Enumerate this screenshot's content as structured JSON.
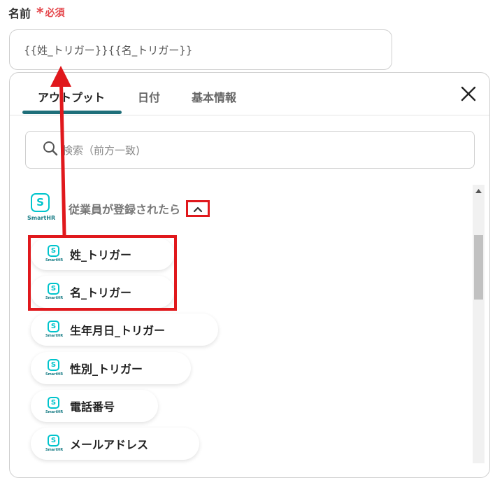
{
  "field": {
    "label": "名前",
    "required_mark": "*",
    "required_text": "必須",
    "value": "{{姓_トリガー}}{{名_トリガー}}"
  },
  "panel": {
    "tabs": [
      {
        "label": "アウトプット",
        "active": true
      },
      {
        "label": "日付",
        "active": false
      },
      {
        "label": "基本情報",
        "active": false
      }
    ],
    "close_icon": "close-icon",
    "search_placeholder": "検索（前方一致)",
    "trigger": {
      "logo_text": "SmartHR",
      "logo_glyph": "S",
      "title": "従業員が登録されたら"
    },
    "items": [
      {
        "label": "姓_トリガー"
      },
      {
        "label": "名_トリガー"
      },
      {
        "label": "生年月日_トリガー"
      },
      {
        "label": "性別_トリガー"
      },
      {
        "label": "電話番号"
      },
      {
        "label": "メールアドレス"
      }
    ]
  },
  "colors": {
    "accent": "#1f6f7a",
    "required": "#e5484d",
    "annotation": "#e0181c",
    "smarthr": "#00c4cc"
  }
}
